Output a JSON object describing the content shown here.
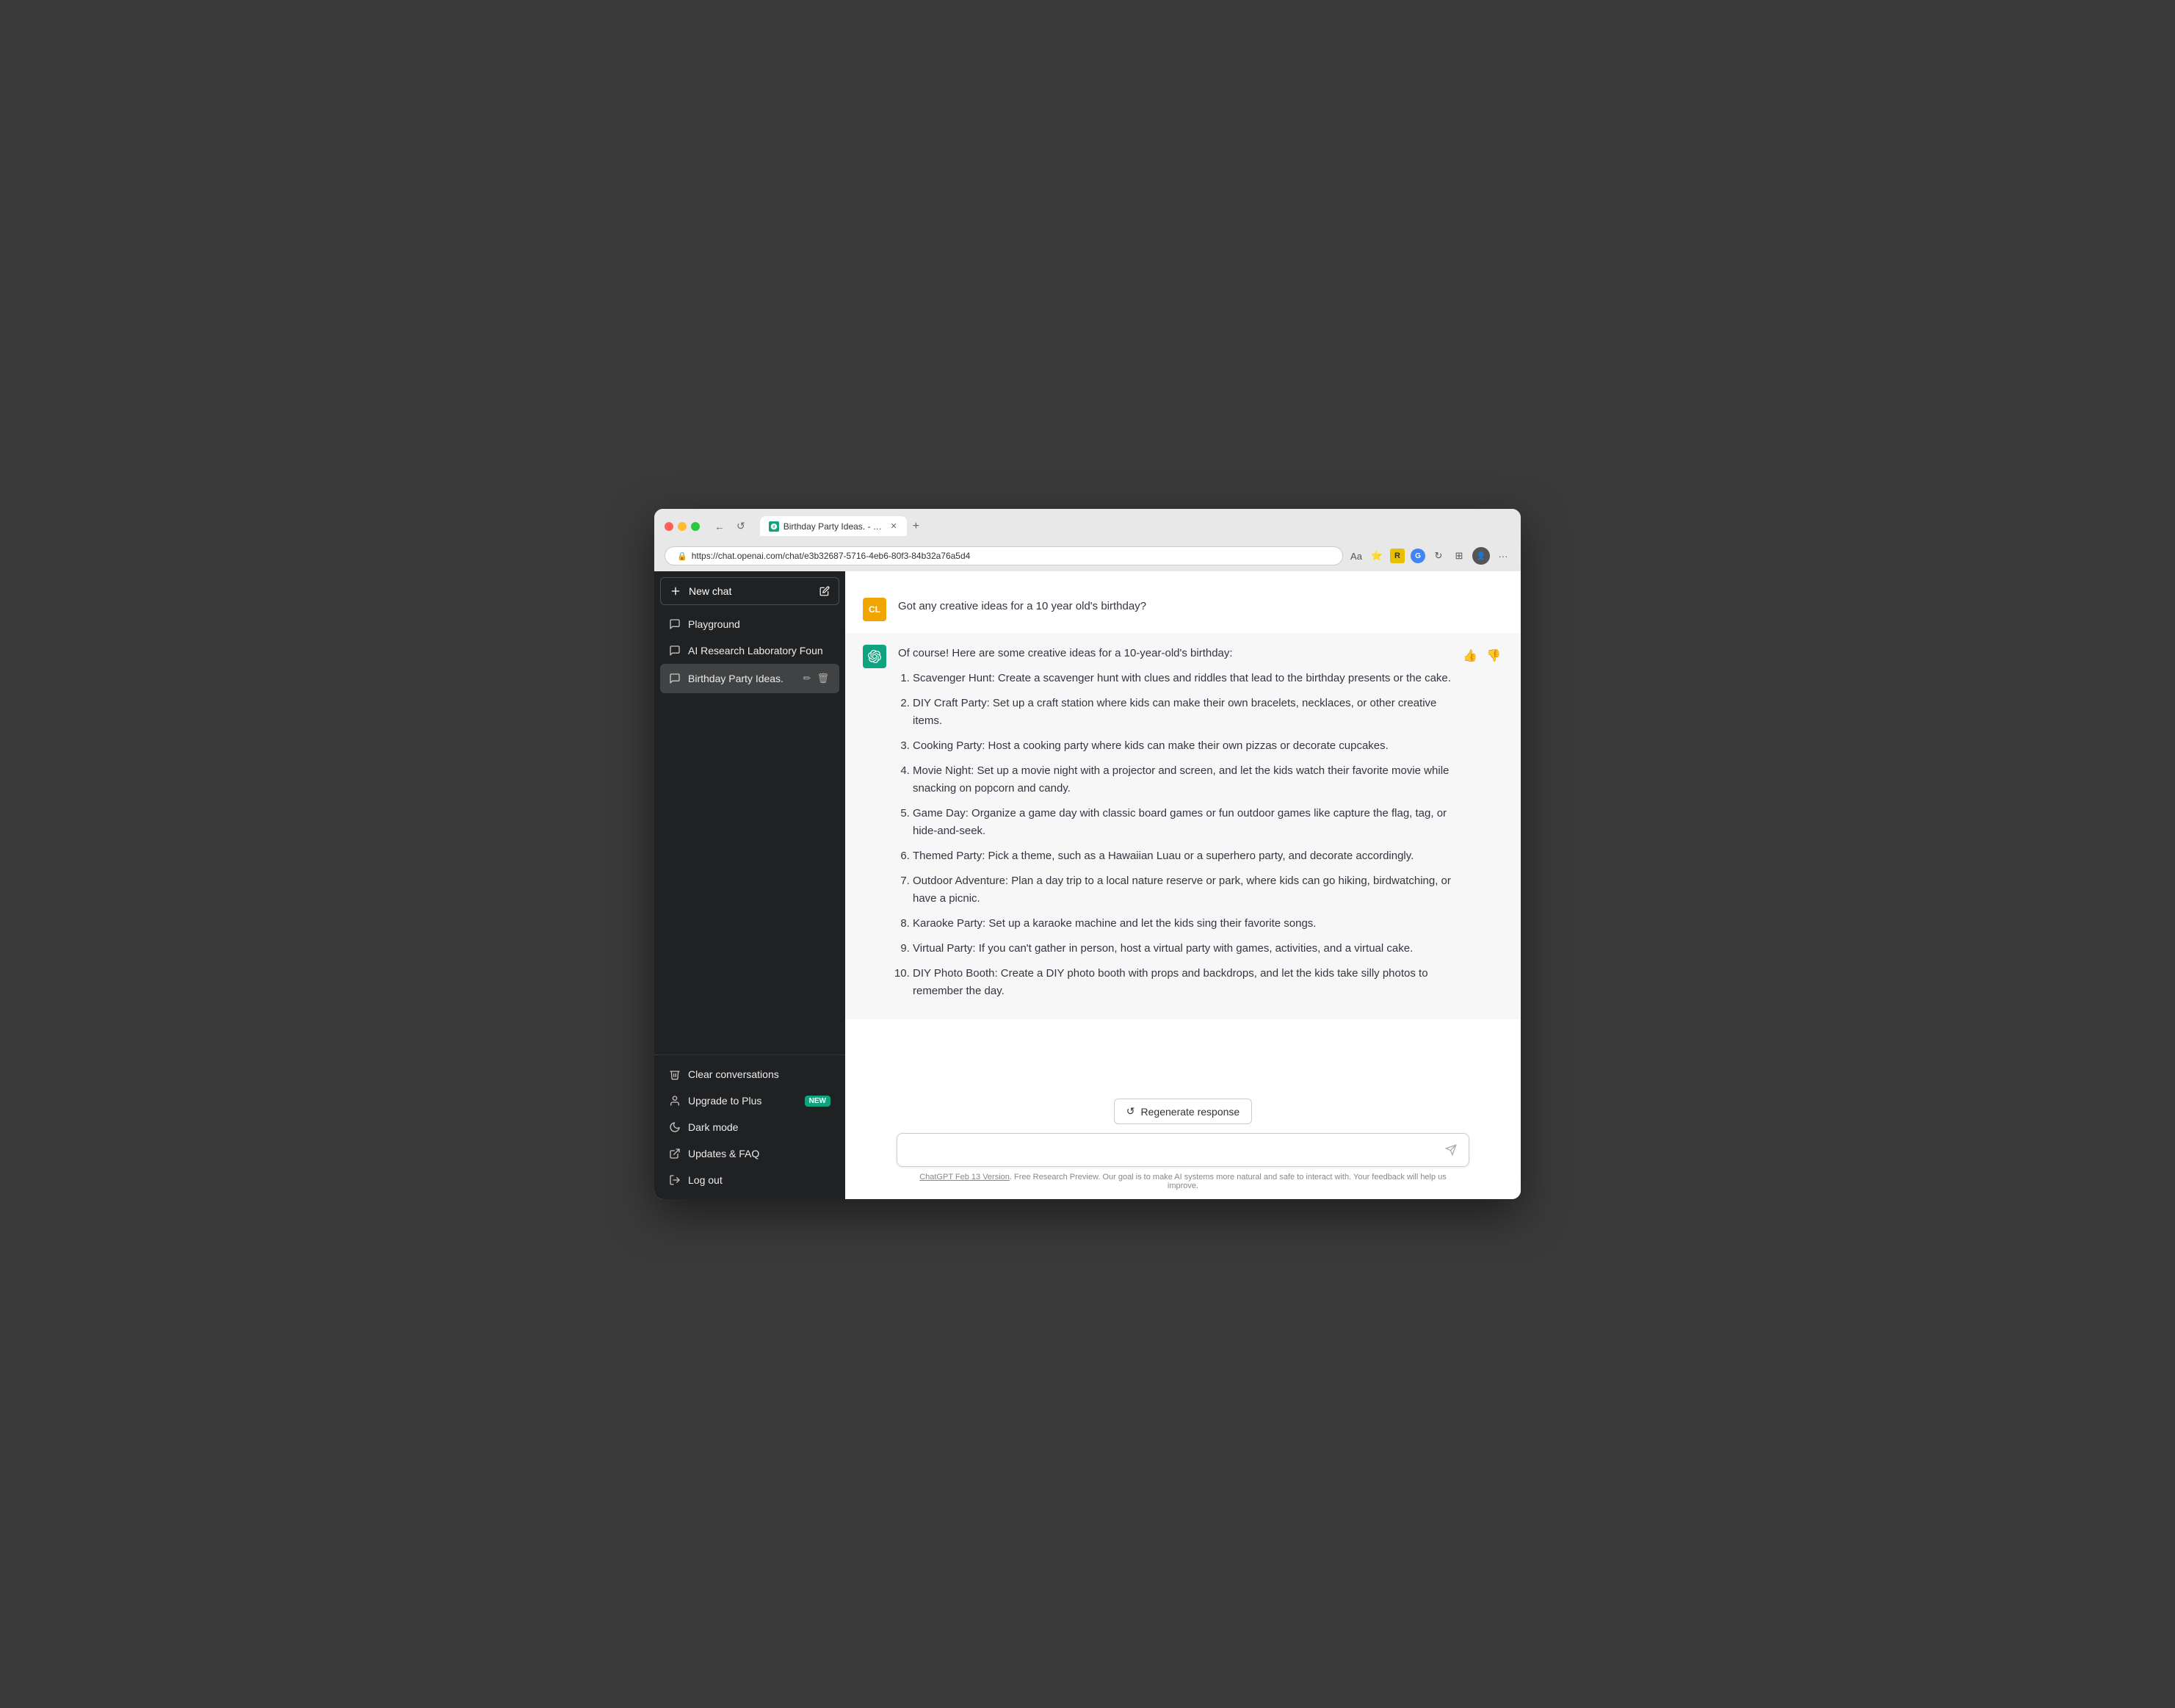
{
  "browser": {
    "tab_title": "Birthday Party Ideas. - https://",
    "url": "https://chat.openai.com/chat/e3b32687-5716-4eb6-80f3-84b32a76a5d4",
    "back_btn": "←",
    "refresh_btn": "↺"
  },
  "sidebar": {
    "new_chat_label": "New chat",
    "items": [
      {
        "id": "playground",
        "label": "Playground",
        "icon": "chat"
      },
      {
        "id": "ai-research",
        "label": "AI Research Laboratory Foun",
        "icon": "chat"
      },
      {
        "id": "birthday-party",
        "label": "Birthday Party Ideas.",
        "icon": "chat",
        "active": true
      }
    ],
    "bottom_items": [
      {
        "id": "clear-conversations",
        "label": "Clear conversations",
        "icon": "trash"
      },
      {
        "id": "upgrade-to-plus",
        "label": "Upgrade to Plus",
        "icon": "user",
        "badge": "NEW"
      },
      {
        "id": "dark-mode",
        "label": "Dark mode",
        "icon": "moon"
      },
      {
        "id": "updates-faq",
        "label": "Updates & FAQ",
        "icon": "external-link"
      },
      {
        "id": "log-out",
        "label": "Log out",
        "icon": "logout"
      }
    ]
  },
  "chat": {
    "messages": [
      {
        "role": "user",
        "avatar_text": "CL",
        "content": "Got any creative ideas for a 10 year old's birthday?"
      },
      {
        "role": "assistant",
        "intro": "Of course! Here are some creative ideas for a 10-year-old's birthday:",
        "items": [
          "Scavenger Hunt: Create a scavenger hunt with clues and riddles that lead to the birthday presents or the cake.",
          "DIY Craft Party: Set up a craft station where kids can make their own bracelets, necklaces, or other creative items.",
          "Cooking Party: Host a cooking party where kids can make their own pizzas or decorate cupcakes.",
          "Movie Night: Set up a movie night with a projector and screen, and let the kids watch their favorite movie while snacking on popcorn and candy.",
          "Game Day: Organize a game day with classic board games or fun outdoor games like capture the flag, tag, or hide-and-seek.",
          "Themed Party: Pick a theme, such as a Hawaiian Luau or a superhero party, and decorate accordingly.",
          "Outdoor Adventure: Plan a day trip to a local nature reserve or park, where kids can go hiking, birdwatching, or have a picnic.",
          "Karaoke Party: Set up a karaoke machine and let the kids sing their favorite songs.",
          "Virtual Party: If you can't gather in person, host a virtual party with games, activities, and a virtual cake.",
          "DIY Photo Booth: Create a DIY photo booth with props and backdrops, and let the kids take silly photos to remember the day."
        ]
      }
    ],
    "regenerate_label": "Regenerate response",
    "input_placeholder": "",
    "footer_text": ". Free Research Preview. Our goal is to make AI systems more natural and safe to interact with. Your feedback will help us improve.",
    "footer_link_text": "ChatGPT Feb 13 Version"
  }
}
